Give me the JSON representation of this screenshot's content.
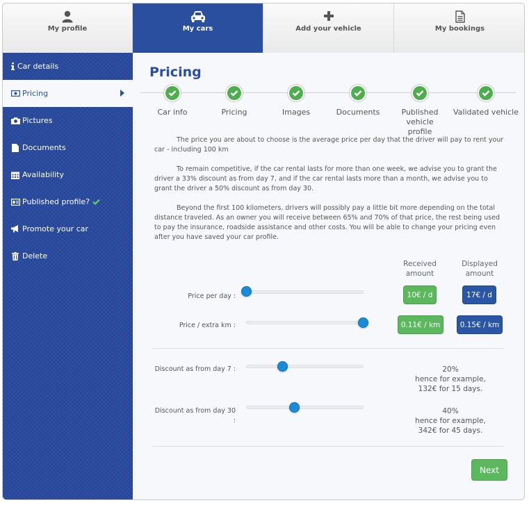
{
  "tabs": [
    {
      "label": "My profile",
      "icon": "user-icon",
      "active": false
    },
    {
      "label": "My cars",
      "icon": "car-icon",
      "active": true
    },
    {
      "label": "Add your vehicle",
      "icon": "plus-icon",
      "active": false
    },
    {
      "label": "My bookings",
      "icon": "document-icon",
      "active": false
    }
  ],
  "sidebar": {
    "items": [
      {
        "label": "Car details",
        "icon": "info-icon"
      },
      {
        "label": "Pricing",
        "icon": "money-icon"
      },
      {
        "label": "Pictures",
        "icon": "camera-icon"
      },
      {
        "label": "Documents",
        "icon": "file-icon"
      },
      {
        "label": "Availability",
        "icon": "calendar-icon"
      },
      {
        "label": "Published profile?",
        "icon": "id-card-icon"
      },
      {
        "label": "Promote your car",
        "icon": "megaphone-icon"
      },
      {
        "label": "Delete",
        "icon": "trash-icon"
      }
    ]
  },
  "main": {
    "title": "Pricing",
    "steps": [
      {
        "label": "Car info"
      },
      {
        "label": "Pricing"
      },
      {
        "label": "Images"
      },
      {
        "label": "Documents"
      },
      {
        "label": "Published vehicle profile"
      },
      {
        "label": "Validated vehicle"
      }
    ],
    "paragraphs": [
      "The price you are about to choose is the average price per day that the driver will pay to rent your car - including 100 km",
      "To remain competitive, if the car rental lasts for more than one week, we advise you to grant the driver a 33% discount as from day 7, and if the car rental lasts more than a month, we advise you to grant the driver a 50% discount as from day 30.",
      "Beyond the first 100 kilometers, drivers will possibly pay a little bit more depending on the total distance traveled. As an owner you will receive between 65% and 70% of that price, the rest being used to pay the insurance, roadside assistance and other costs. You will be able to change your pricing even after you have saved your car profile."
    ],
    "columns": {
      "received": "Received amount",
      "displayed": "Displayed amount"
    },
    "price_per_day": {
      "label": "Price per day :",
      "received": "10€ / d",
      "displayed": "17€ / d",
      "slider_level": 0.0
    },
    "price_extra_km": {
      "label": "Price / extra km :",
      "received": "0.11€ / km",
      "displayed": "0.15€ / km",
      "slider_level": 1.0
    },
    "discount_day7": {
      "label": "Discount as from day 7 :",
      "value": "20%",
      "note": "hence for example,",
      "example": "132€ for 15 days.",
      "slider_level": 0.31
    },
    "discount_day30": {
      "label": "Discount as from day 30 :",
      "value": "40%",
      "note": "hence for example,",
      "example": "342€ for 45 days.",
      "slider_level": 0.41
    },
    "next_label": "Next"
  },
  "colors": {
    "brand_blue": "#2a4f9e",
    "success_green": "#5cb85c",
    "slider_blue": "#1a8bd6"
  }
}
